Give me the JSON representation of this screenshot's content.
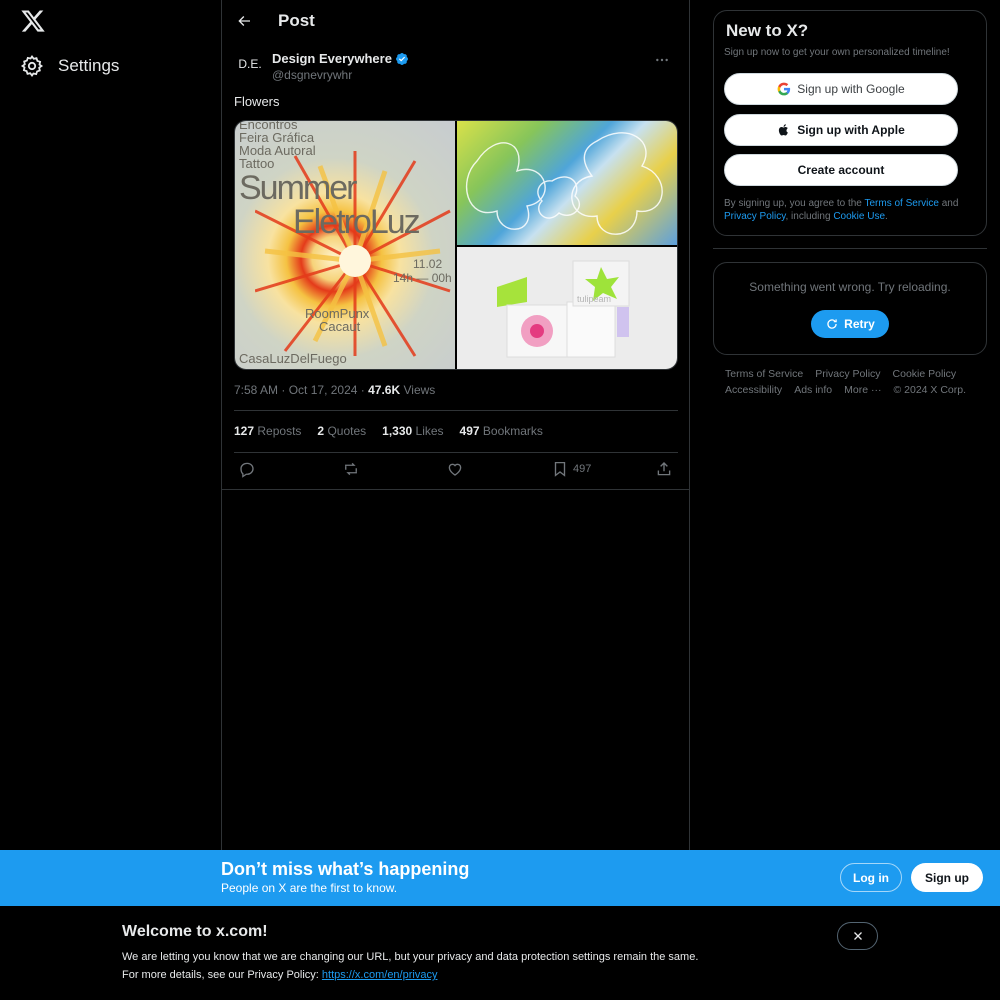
{
  "nav": {
    "logo_icon": "x-logo-icon",
    "settings_label": "Settings",
    "settings_icon": "gear-icon"
  },
  "header": {
    "title": "Post",
    "back_icon": "arrow-left-icon"
  },
  "post": {
    "author_avatar": "D.E.",
    "author_name": "Design Everywhere",
    "author_handle": "@dsgnevrywhr",
    "verified": true,
    "text": "Flowers",
    "image1_text": {
      "line1": "Encontros",
      "line2": "Feira Gráfica",
      "line3": "Moda Autoral",
      "line4": "Tattoo",
      "big1": "Summer",
      "big2": "EletroLuz",
      "date": "11.02",
      "time": "14h — 00h",
      "venue1": "RoomPunx",
      "venue2": "Cacaut",
      "bottom": "CasaLuzDelFuego"
    },
    "image3_text": "tulipeam",
    "time": "7:58 AM",
    "date": "Oct 17, 2024",
    "views_count": "47.6K",
    "views_label": "Views",
    "reposts_count": "127",
    "reposts_label": "Reposts",
    "quotes_count": "2",
    "quotes_label": "Quotes",
    "likes_count": "1,330",
    "likes_label": "Likes",
    "bookmarks_count": "497",
    "bookmarks_label": "Bookmarks",
    "bookmark_action_count": "497"
  },
  "signup": {
    "title": "New to X?",
    "subtitle": "Sign up now to get your own personalized timeline!",
    "google_label": "Sign up with Google",
    "apple_label": "Sign up with Apple",
    "create_label": "Create account",
    "terms_prefix": "By signing up, you agree to the ",
    "terms_link": "Terms of Service",
    "terms_and": " and ",
    "privacy_link": "Privacy Policy",
    "terms_including": ", including ",
    "cookie_link": "Cookie Use",
    "terms_suffix": "."
  },
  "error": {
    "message": "Something went wrong. Try reloading.",
    "retry_label": "Retry"
  },
  "footer": {
    "terms": "Terms of Service",
    "privacy": "Privacy Policy",
    "cookie": "Cookie Policy",
    "accessibility": "Accessibility",
    "ads": "Ads info",
    "more": "More ···",
    "copyright": "© 2024 X Corp."
  },
  "banner": {
    "title": "Don’t miss what’s happening",
    "subtitle": "People on X are the first to know.",
    "login_label": "Log in",
    "signup_label": "Sign up"
  },
  "welcome": {
    "title": "Welcome to x.com!",
    "line1": "We are letting you know that we are changing our URL, but your privacy and data protection settings remain the same.",
    "line2_prefix": "For more details, see our Privacy Policy: ",
    "line2_link": "https://x.com/en/privacy"
  },
  "colors": {
    "background": "#000000",
    "accent": "#1d9bf0",
    "text_primary": "#e7e9ea",
    "text_secondary": "#71767b",
    "border": "#2f3336"
  }
}
